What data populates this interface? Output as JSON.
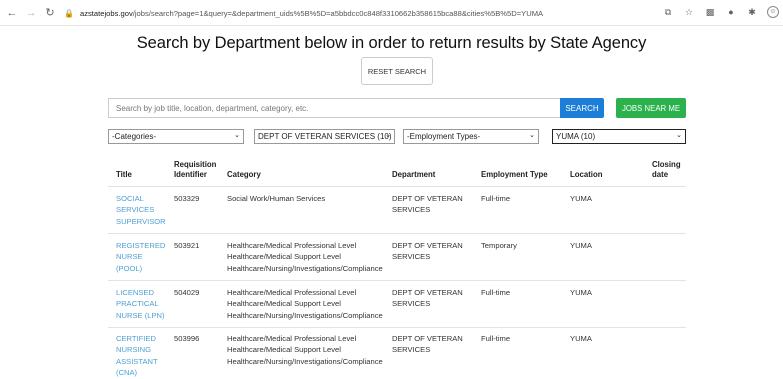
{
  "browser": {
    "url_domain": "azstatejobs.gov",
    "url_path": "/jobs/search?page=1&query=&department_uids%5B%5D=a5bbdcc0c848f3310662b358615bca88&cities%5B%5D=YUMA"
  },
  "page": {
    "title": "Search by Department below in order to return results by State Agency",
    "reset_label": "RESET SEARCH"
  },
  "search": {
    "placeholder": "Search by job title, location, department, category, etc.",
    "search_label": "SEARCH",
    "near_label": "JOBS NEAR ME"
  },
  "filters": {
    "categories": "-Categories-",
    "department": "DEPT OF VETERAN SERVICES (10)",
    "employment_type": "-Employment Types-",
    "location": "YUMA (10)"
  },
  "table": {
    "headers": {
      "title": "Title",
      "req_line1": "Requisition",
      "req_line2": "Identifier",
      "category": "Category",
      "department": "Department",
      "employment_type": "Employment Type",
      "location": "Location",
      "closing_line1": "Closing",
      "closing_line2": "date"
    },
    "rows": [
      {
        "title": [
          "SOCIAL",
          "SERVICES",
          "SUPERVISOR"
        ],
        "requisition": "503329",
        "categories": [
          "Social Work/Human Services"
        ],
        "department": [
          "DEPT OF VETERAN",
          "SERVICES"
        ],
        "employment_type": "Full-time",
        "location": "YUMA"
      },
      {
        "title": [
          "REGISTERED",
          "NURSE",
          "(POOL)"
        ],
        "requisition": "503921",
        "categories": [
          "Healthcare/Medical Professional Level",
          "Healthcare/Medical Support Level",
          "Healthcare/Nursing/Investigations/Compliance"
        ],
        "department": [
          "DEPT OF VETERAN",
          "SERVICES"
        ],
        "employment_type": "Temporary",
        "location": "YUMA"
      },
      {
        "title": [
          "LICENSED",
          "PRACTICAL",
          "NURSE (LPN)"
        ],
        "requisition": "504029",
        "categories": [
          "Healthcare/Medical Professional Level",
          "Healthcare/Medical Support Level",
          "Healthcare/Nursing/Investigations/Compliance"
        ],
        "department": [
          "DEPT OF VETERAN",
          "SERVICES"
        ],
        "employment_type": "Full-time",
        "location": "YUMA"
      },
      {
        "title": [
          "CERTIFIED",
          "NURSING",
          "ASSISTANT",
          "(CNA)"
        ],
        "requisition": "503996",
        "categories": [
          "Healthcare/Medical Professional Level",
          "Healthcare/Medical Support Level",
          "Healthcare/Nursing/Investigations/Compliance"
        ],
        "department": [
          "DEPT OF VETERAN",
          "SERVICES"
        ],
        "employment_type": "Full-time",
        "location": "YUMA"
      }
    ]
  },
  "icons": [
    "back-arrow-icon",
    "forward-arrow-icon",
    "reload-icon",
    "lock-icon",
    "share-icon",
    "star-icon",
    "extension-icon",
    "puzzle-icon",
    "profile-icon"
  ]
}
